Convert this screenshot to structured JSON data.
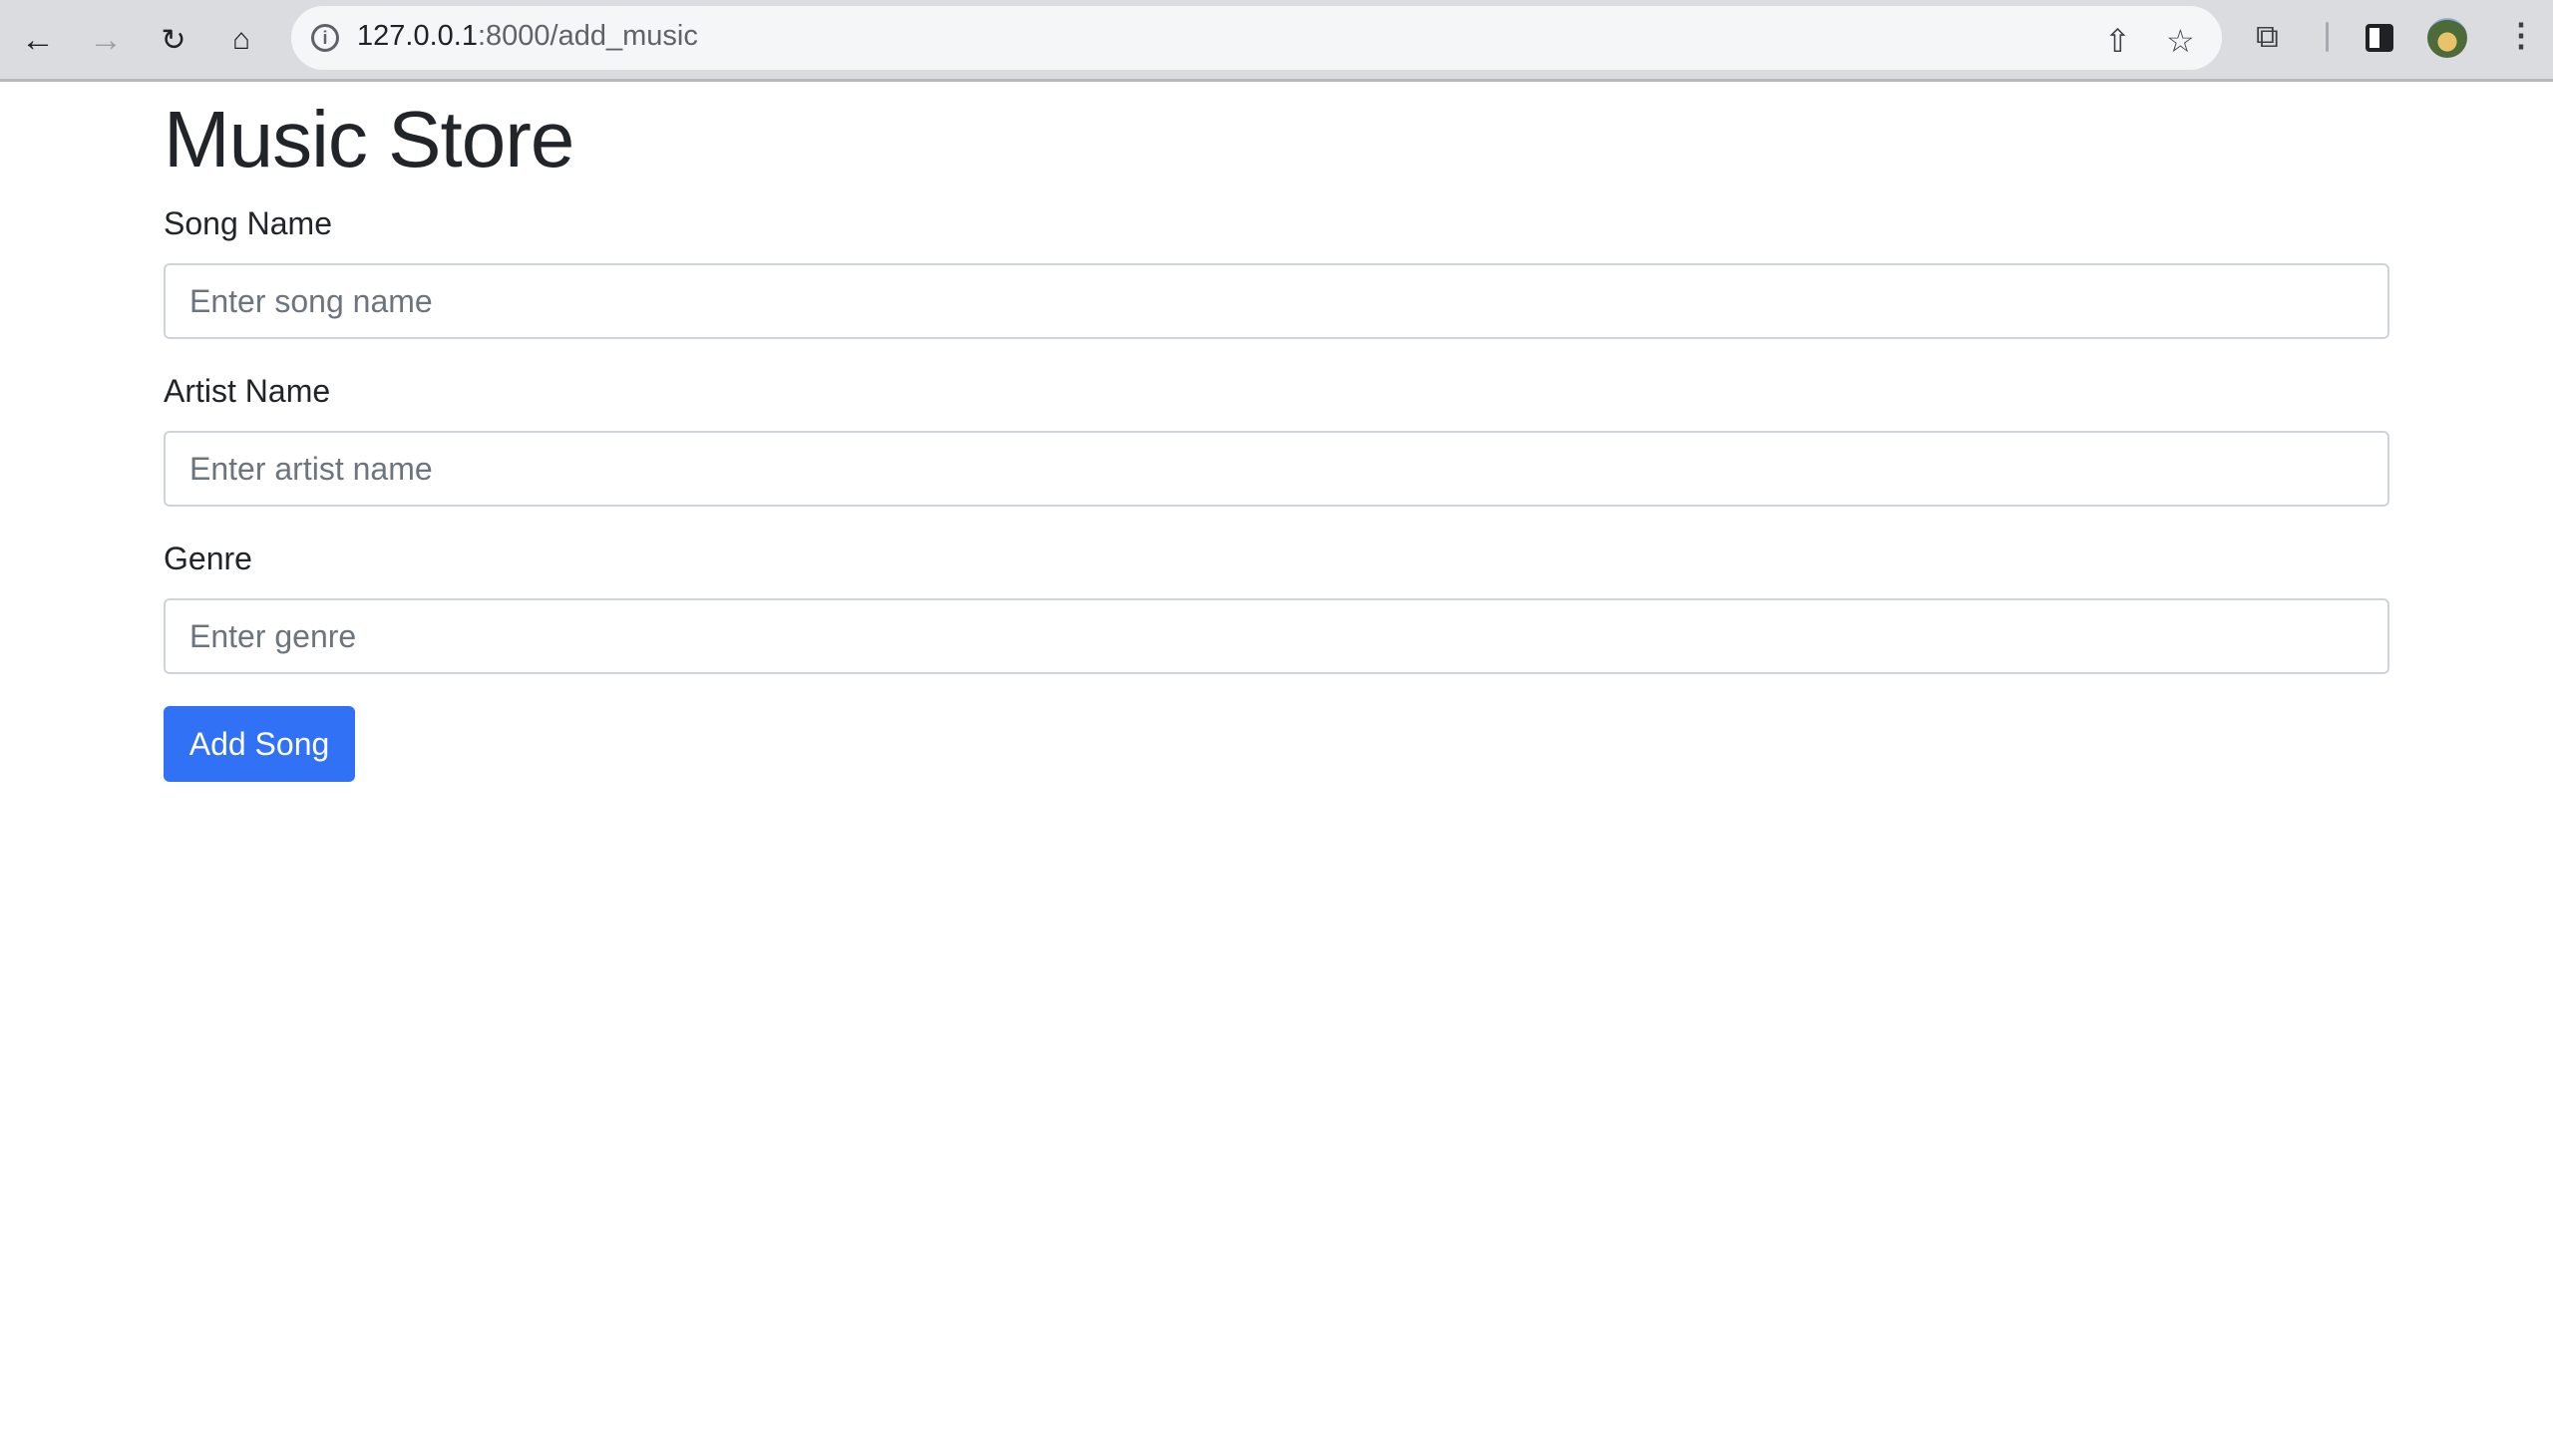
{
  "browser": {
    "url_host": "127.0.0.1",
    "url_rest": ":8000/add_music",
    "icons": [
      "back-icon",
      "forward-icon",
      "reload-icon",
      "home-icon",
      "info-icon",
      "share-icon",
      "star-icon",
      "extensions-icon",
      "side-panel-icon",
      "avatar",
      "menu-icon"
    ]
  },
  "page": {
    "title": "Music Store",
    "fields": [
      {
        "label": "Song Name",
        "placeholder": "Enter song name",
        "value": ""
      },
      {
        "label": "Artist Name",
        "placeholder": "Enter artist name",
        "value": ""
      },
      {
        "label": "Genre",
        "placeholder": "Enter genre",
        "value": ""
      }
    ],
    "submit_label": "Add Song",
    "accent": "#3071f5"
  }
}
